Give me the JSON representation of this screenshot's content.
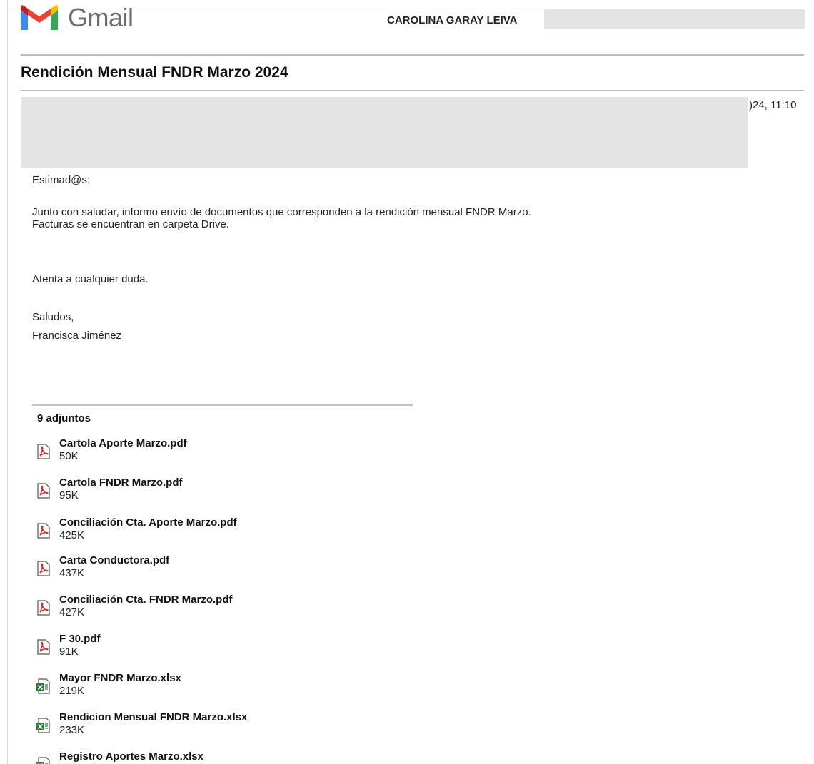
{
  "header": {
    "logo_text": "Gmail",
    "account_name": "CAROLINA GARAY LEIVA"
  },
  "message": {
    "subject": "Rendición Mensual FNDR Marzo 2024",
    "date_fragment": ")24, 11:10",
    "body": {
      "greeting": "Estimad@s:",
      "paragraph_line1": "Junto con saludar, informo envío de documentos que corresponden a la rendición mensual FNDR Marzo.",
      "paragraph_line2": "Facturas se encuentran en carpeta Drive.",
      "closing": "Atenta a cualquier duda.",
      "signoff": "Saludos,",
      "signature": "Francisca Jiménez"
    }
  },
  "attachments": {
    "count_label": "9 adjuntos",
    "items": [
      {
        "name": "Cartola Aporte Marzo.pdf",
        "size": "50K",
        "icon": "pdf-icon"
      },
      {
        "name": "Cartola FNDR Marzo.pdf",
        "size": "95K",
        "icon": "pdf-icon"
      },
      {
        "name": "Conciliación Cta. Aporte Marzo.pdf",
        "size": "425K",
        "icon": "pdf-icon"
      },
      {
        "name": "Carta Conductora.pdf",
        "size": "437K",
        "icon": "pdf-icon"
      },
      {
        "name": "Conciliación Cta. FNDR Marzo.pdf",
        "size": "427K",
        "icon": "pdf-icon"
      },
      {
        "name": "F 30.pdf",
        "size": "91K",
        "icon": "pdf-icon"
      },
      {
        "name": "Mayor FNDR Marzo.xlsx",
        "size": "219K",
        "icon": "spreadsheet-icon"
      },
      {
        "name": "Rendicion Mensual FNDR Marzo.xlsx",
        "size": "233K",
        "icon": "spreadsheet-icon"
      },
      {
        "name": "Registro Aportes Marzo.xlsx",
        "size": "",
        "icon": "spreadsheet-icon"
      }
    ]
  },
  "colors": {
    "gmail_red": "#EA4335",
    "gmail_blue": "#4285F4",
    "gmail_green": "#34A853",
    "gmail_yellow": "#FBBC04",
    "redaction_gray": "#E4E4E4",
    "pdf_red": "#D32F2F",
    "xlsx_green": "#2E7D32"
  }
}
